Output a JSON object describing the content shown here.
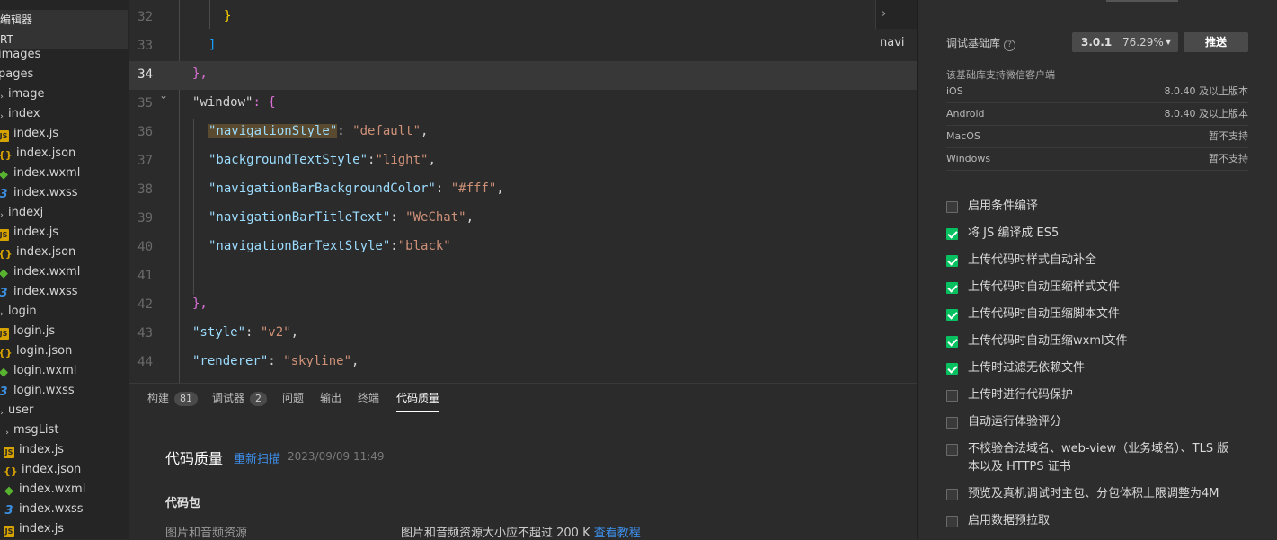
{
  "tree": {
    "header1": "编辑器",
    "header2": "RT",
    "rows": [
      {
        "label": "images",
        "kind": "folder-partial"
      },
      {
        "label": "pages",
        "kind": "folder-partial"
      },
      {
        "label": "image",
        "kind": "folder"
      },
      {
        "label": "index",
        "kind": "folder"
      },
      {
        "label": "index.js",
        "kind": "js"
      },
      {
        "label": "index.json",
        "kind": "json"
      },
      {
        "label": "index.wxml",
        "kind": "wxml"
      },
      {
        "label": "index.wxss",
        "kind": "wxss"
      },
      {
        "label": "indexj",
        "kind": "folder"
      },
      {
        "label": "index.js",
        "kind": "js"
      },
      {
        "label": "index.json",
        "kind": "json"
      },
      {
        "label": "index.wxml",
        "kind": "wxml"
      },
      {
        "label": "index.wxss",
        "kind": "wxss"
      },
      {
        "label": "login",
        "kind": "folder"
      },
      {
        "label": "login.js",
        "kind": "js"
      },
      {
        "label": "login.json",
        "kind": "json"
      },
      {
        "label": "login.wxml",
        "kind": "wxml"
      },
      {
        "label": "login.wxss",
        "kind": "wxss"
      },
      {
        "label": "user",
        "kind": "folder"
      },
      {
        "label": "msgList",
        "kind": "folder"
      },
      {
        "label": "index.js",
        "kind": "js"
      },
      {
        "label": "index.json",
        "kind": "json"
      },
      {
        "label": "index.wxml",
        "kind": "wxml"
      },
      {
        "label": "index.wxss",
        "kind": "wxss"
      },
      {
        "label": "index.js",
        "kind": "js"
      }
    ]
  },
  "editor": {
    "line_numbers": [
      "32",
      "33",
      "34",
      "35",
      "36",
      "37",
      "38",
      "39",
      "40",
      "41",
      "42",
      "43",
      "44"
    ],
    "current_line": "34",
    "breadcrumb_fragment": "navi",
    "lines": {
      "l32": "}",
      "l33": "]",
      "l34": "},",
      "l35_key": "\"window\"",
      "l35_rest": ": {",
      "l36_key": "\"navigationStyle\"",
      "l36_val": "\"default\"",
      "l37_key": "\"backgroundTextStyle\"",
      "l37_val": "\"light\"",
      "l38_key": "\"navigationBarBackgroundColor\"",
      "l38_val": "\"#fff\"",
      "l39_key": "\"navigationBarTitleText\"",
      "l39_val": "\"WeChat\"",
      "l40_key": "\"navigationBarTextStyle\"",
      "l40_val": "\"black\"",
      "l42": "},",
      "l43_key": "\"style\"",
      "l43_val": "\"v2\"",
      "l44_key": "\"renderer\"",
      "l44_val": "\"skyline\""
    }
  },
  "panel": {
    "tabs": [
      {
        "label": "构建",
        "badge": "81"
      },
      {
        "label": "调试器",
        "badge": "2"
      },
      {
        "label": "问题",
        "badge": ""
      },
      {
        "label": "输出",
        "badge": ""
      },
      {
        "label": "终端",
        "badge": ""
      },
      {
        "label": "代码质量",
        "badge": "",
        "active": true
      }
    ],
    "title": "代码质量",
    "rescan": "重新扫描",
    "timestamp": "2023/09/09 11:49",
    "section": "代码包",
    "item_name": "图片和音频资源",
    "item_desc": "图片和音频资源大小应不超过 200 K",
    "item_link": "查看教程"
  },
  "settings": {
    "base_lib_label": "调试基础库",
    "help_icon": "?",
    "version": "3.0.1",
    "version_pct": "76.29%",
    "push_label": "推送",
    "support_note": "该基础库支持微信客户端",
    "platforms": [
      {
        "name": "iOS",
        "value": "8.0.40 及以上版本"
      },
      {
        "name": "Android",
        "value": "8.0.40 及以上版本"
      },
      {
        "name": "MacOS",
        "value": "暂不支持"
      },
      {
        "name": "Windows",
        "value": "暂不支持"
      }
    ],
    "options": [
      {
        "label": "启用条件编译",
        "checked": false
      },
      {
        "label": "将 JS 编译成 ES5",
        "checked": true
      },
      {
        "label": "上传代码时样式自动补全",
        "checked": true
      },
      {
        "label": "上传代码时自动压缩样式文件",
        "checked": true
      },
      {
        "label": "上传代码时自动压缩脚本文件",
        "checked": true
      },
      {
        "label": "上传代码时自动压缩wxml文件",
        "checked": true
      },
      {
        "label": "上传时过滤无依赖文件",
        "checked": true
      },
      {
        "label": "上传时进行代码保护",
        "checked": false
      },
      {
        "label": "自动运行体验评分",
        "checked": false
      },
      {
        "label": "不校验合法域名、web-view（业务域名）、TLS 版",
        "label2": "本以及 HTTPS 证书",
        "checked": false
      },
      {
        "label": "预览及真机调试时主包、分包体积上限调整为4M",
        "checked": false
      },
      {
        "label": "启用数据预拉取",
        "checked": false
      }
    ],
    "accent_color": "#07c160"
  }
}
